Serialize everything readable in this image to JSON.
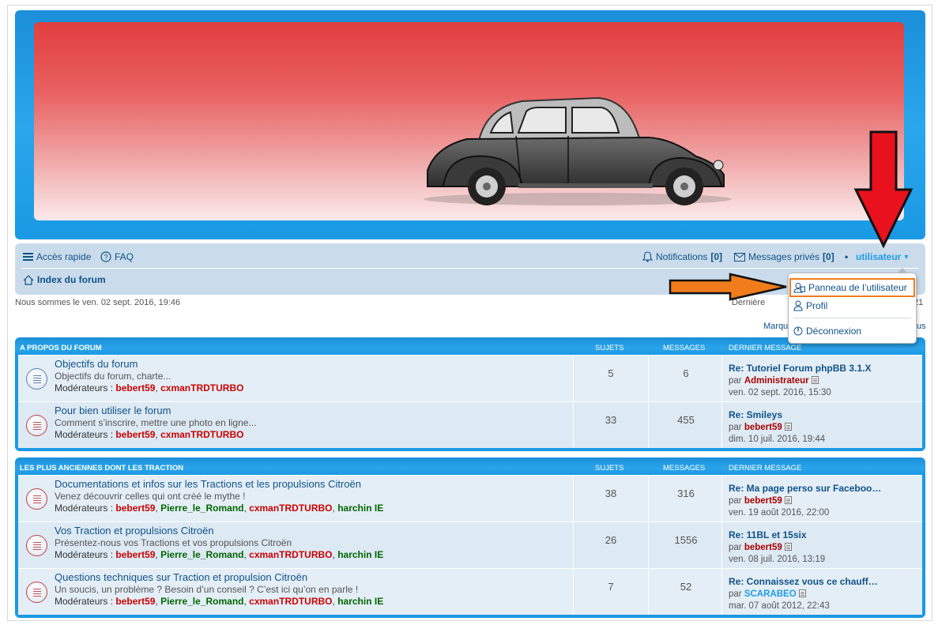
{
  "nav": {
    "quick_access": "Accès rapide",
    "faq": "FAQ",
    "notifications_label": "Notifications",
    "notifications_count": "[0]",
    "pm_label": "Messages privés",
    "pm_count": "[0]",
    "separator": "•",
    "user": "utilisateur",
    "user_caret": "▾",
    "home": "Index du forum"
  },
  "info": {
    "date": "Nous sommes le ven. 02 sept. 2016, 19:46",
    "last_visit_start": "Dernière visi",
    "last_visit_end": "21",
    "mark_start": "Marqu",
    "mark_end": "us"
  },
  "dropdown": {
    "ucp": "Panneau de l’utilisateur",
    "profile": "Profil",
    "logout": "Déconnexion"
  },
  "categories": [
    {
      "title": "A PROPOS DU FORUM",
      "col_topics": "SUJETS",
      "col_posts": "MESSAGES",
      "col_last": "DERNIER MESSAGE",
      "forums": [
        {
          "title": "Objectifs du forum",
          "desc": "Objectifs du forum, charte...",
          "mods_label": "Modérateurs :",
          "mods": [
            {
              "name": "bebert59",
              "sep": ", "
            },
            {
              "name": "cxmanTRDTURBO",
              "sep": ""
            }
          ],
          "topics": "5",
          "posts": "6",
          "last_title": "Re: Tutoriel Forum phpBB 3.1.X",
          "last_by": "par",
          "last_author": "Administrateur",
          "last_date": "ven. 02 sept. 2016, 15:30"
        },
        {
          "title": "Pour bien utiliser le forum",
          "desc": "Comment s’inscrire, mettre une photo en ligne...",
          "mods_label": "Modérateurs :",
          "mods": [
            {
              "name": "bebert59",
              "sep": ", "
            },
            {
              "name": "cxmanTRDTURBO",
              "sep": ""
            }
          ],
          "topics": "33",
          "posts": "455",
          "last_title": "Re: Smileys",
          "last_by": "par",
          "last_author": "bebert59",
          "last_date": "dim. 10 juil. 2016, 19:44"
        }
      ]
    },
    {
      "title": "LES PLUS ANCIENNES DONT LES TRACTION",
      "col_topics": "SUJETS",
      "col_posts": "MESSAGES",
      "col_last": "DERNIER MESSAGE",
      "forums": [
        {
          "title": "Documentations et infos sur les Tractions et les propulsions Citroën",
          "desc": "Venez découvrir celles qui ont créé le mythe !",
          "mods_label": "Modérateurs :",
          "mods": [
            {
              "name": "bebert59",
              "sep": ", "
            },
            {
              "name": "Pierre_le_Romand",
              "sep": ", "
            },
            {
              "name": "cxmanTRDTURBO",
              "sep": ", "
            },
            {
              "name": "harchin IE",
              "sep": ""
            }
          ],
          "topics": "38",
          "posts": "316",
          "last_title": "Re: Ma page perso sur Faceboo…",
          "last_by": "par",
          "last_author": "bebert59",
          "last_date": "ven. 19 août 2016, 22:00"
        },
        {
          "title": "Vos Traction et propulsions Citroën",
          "desc": "Présentez-nous vos Tractions et vos propulsions Citroën",
          "mods_label": "Modérateurs :",
          "mods": [
            {
              "name": "bebert59",
              "sep": ", "
            },
            {
              "name": "Pierre_le_Romand",
              "sep": ", "
            },
            {
              "name": "cxmanTRDTURBO",
              "sep": ", "
            },
            {
              "name": "harchin IE",
              "sep": ""
            }
          ],
          "topics": "26",
          "posts": "1556",
          "last_title": "Re: 11BL et 15six",
          "last_by": "par",
          "last_author": "bebert59",
          "last_date": "ven. 08 juil. 2016, 13:19"
        },
        {
          "title": "Questions techniques sur Traction et propulsion Citroën",
          "desc": "Un soucis, un problème ? Besoin d’un conseil ? C’est ici qu’on en parle !",
          "mods_label": "Modérateurs :",
          "mods": [
            {
              "name": "bebert59",
              "sep": ", "
            },
            {
              "name": "Pierre_le_Romand",
              "sep": ", "
            },
            {
              "name": "cxmanTRDTURBO",
              "sep": ", "
            },
            {
              "name": "harchin IE",
              "sep": ""
            }
          ],
          "topics": "7",
          "posts": "52",
          "last_title": "Re: Connaissez vous ce chauff…",
          "last_by": "par",
          "last_author": "SCARABEO",
          "last_date": "mar. 07 août 2012, 22:43"
        }
      ]
    }
  ],
  "colors": {
    "header_blue": "#1a99e4",
    "link": "#105289",
    "annotation_red": "#e8111d",
    "annotation_orange": "#f07c1b"
  }
}
